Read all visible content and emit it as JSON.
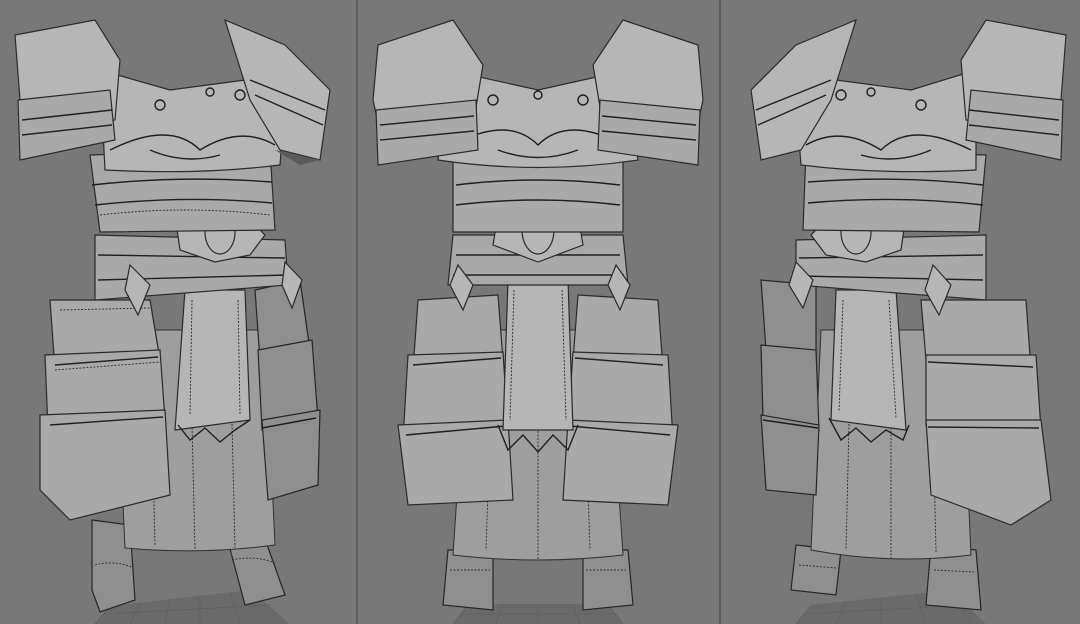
{
  "viewports": [
    {
      "id": "left",
      "view": "three-quarter-left"
    },
    {
      "id": "mid",
      "view": "front"
    },
    {
      "id": "right",
      "view": "three-quarter-right"
    }
  ],
  "colors": {
    "background": "#777777",
    "model_base": "#a9a9a9",
    "model_light": "#b6b6b6",
    "model_dark": "#8f8f8f",
    "edge": "#222222",
    "divider": "#5e5e5e",
    "floor_grid": "#6a6a6a"
  },
  "icons": {
    "armor_model": "armor-model-icon"
  }
}
